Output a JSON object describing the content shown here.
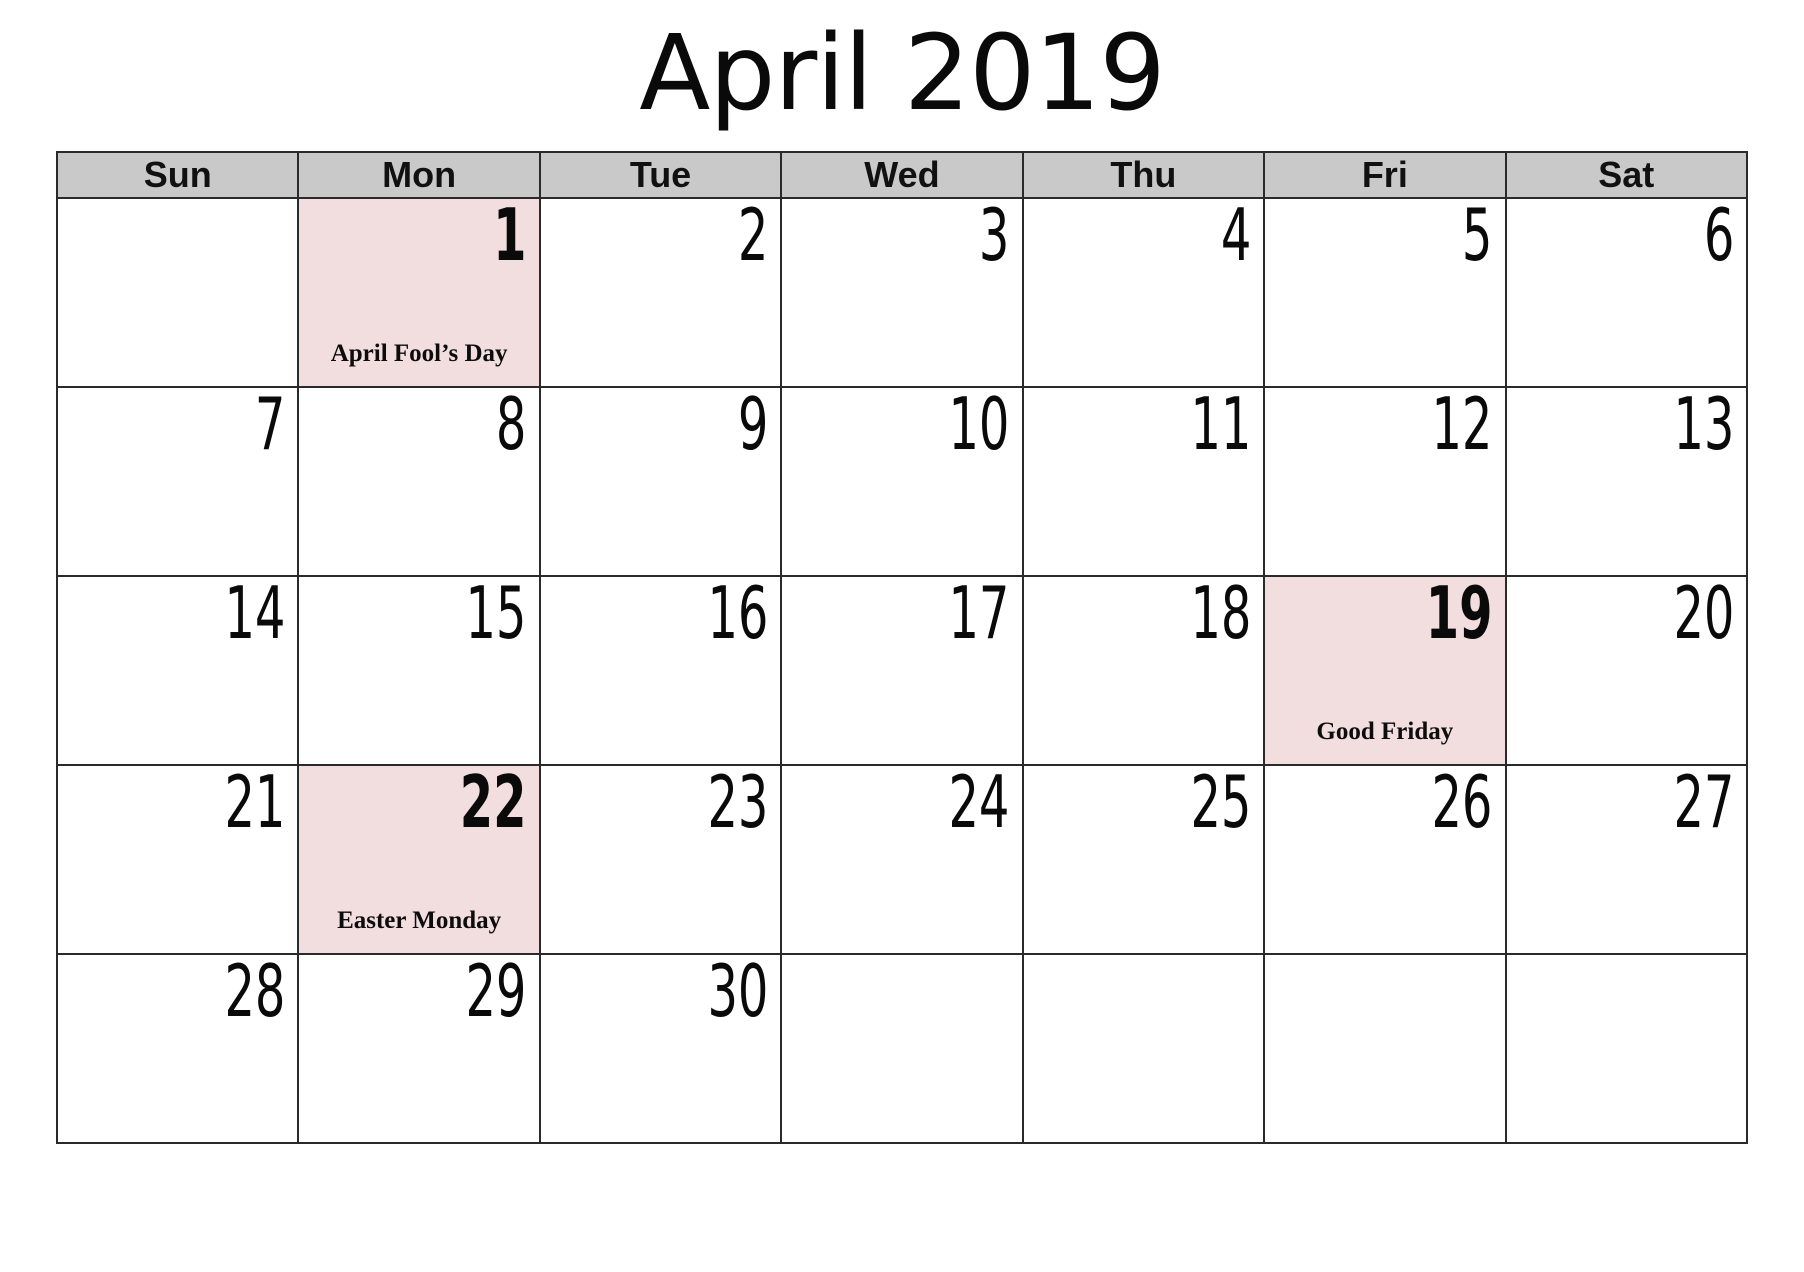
{
  "calendar": {
    "title": "April 2019",
    "month": "April",
    "year": "2019",
    "weekday_headers": [
      "Sun",
      "Mon",
      "Tue",
      "Wed",
      "Thu",
      "Fri",
      "Sat"
    ],
    "colors": {
      "holiday_background": "#f3dedf",
      "header_background": "#c9c9c9",
      "grid_line": "#2a2a2a",
      "text": "#0a0a0a",
      "page_background": "#ffffff"
    },
    "weeks": [
      [
        {
          "day": "",
          "note": "",
          "holiday": false,
          "empty": true
        },
        {
          "day": "1",
          "note": "April Fool’s Day",
          "holiday": true,
          "empty": false
        },
        {
          "day": "2",
          "note": "",
          "holiday": false,
          "empty": false
        },
        {
          "day": "3",
          "note": "",
          "holiday": false,
          "empty": false
        },
        {
          "day": "4",
          "note": "",
          "holiday": false,
          "empty": false
        },
        {
          "day": "5",
          "note": "",
          "holiday": false,
          "empty": false
        },
        {
          "day": "6",
          "note": "",
          "holiday": false,
          "empty": false
        }
      ],
      [
        {
          "day": "7",
          "note": "",
          "holiday": false,
          "empty": false
        },
        {
          "day": "8",
          "note": "",
          "holiday": false,
          "empty": false
        },
        {
          "day": "9",
          "note": "",
          "holiday": false,
          "empty": false
        },
        {
          "day": "10",
          "note": "",
          "holiday": false,
          "empty": false
        },
        {
          "day": "11",
          "note": "",
          "holiday": false,
          "empty": false
        },
        {
          "day": "12",
          "note": "",
          "holiday": false,
          "empty": false
        },
        {
          "day": "13",
          "note": "",
          "holiday": false,
          "empty": false
        }
      ],
      [
        {
          "day": "14",
          "note": "",
          "holiday": false,
          "empty": false
        },
        {
          "day": "15",
          "note": "",
          "holiday": false,
          "empty": false
        },
        {
          "day": "16",
          "note": "",
          "holiday": false,
          "empty": false
        },
        {
          "day": "17",
          "note": "",
          "holiday": false,
          "empty": false
        },
        {
          "day": "18",
          "note": "",
          "holiday": false,
          "empty": false
        },
        {
          "day": "19",
          "note": "Good Friday",
          "holiday": true,
          "empty": false
        },
        {
          "day": "20",
          "note": "",
          "holiday": false,
          "empty": false
        }
      ],
      [
        {
          "day": "21",
          "note": "",
          "holiday": false,
          "empty": false
        },
        {
          "day": "22",
          "note": "Easter Monday",
          "holiday": true,
          "empty": false
        },
        {
          "day": "23",
          "note": "",
          "holiday": false,
          "empty": false
        },
        {
          "day": "24",
          "note": "",
          "holiday": false,
          "empty": false
        },
        {
          "day": "25",
          "note": "",
          "holiday": false,
          "empty": false
        },
        {
          "day": "26",
          "note": "",
          "holiday": false,
          "empty": false
        },
        {
          "day": "27",
          "note": "",
          "holiday": false,
          "empty": false
        }
      ],
      [
        {
          "day": "28",
          "note": "",
          "holiday": false,
          "empty": false
        },
        {
          "day": "29",
          "note": "",
          "holiday": false,
          "empty": false
        },
        {
          "day": "30",
          "note": "",
          "holiday": false,
          "empty": false
        },
        {
          "day": "",
          "note": "",
          "holiday": false,
          "empty": true
        },
        {
          "day": "",
          "note": "",
          "holiday": false,
          "empty": true
        },
        {
          "day": "",
          "note": "",
          "holiday": false,
          "empty": true
        },
        {
          "day": "",
          "note": "",
          "holiday": false,
          "empty": true
        }
      ]
    ]
  }
}
